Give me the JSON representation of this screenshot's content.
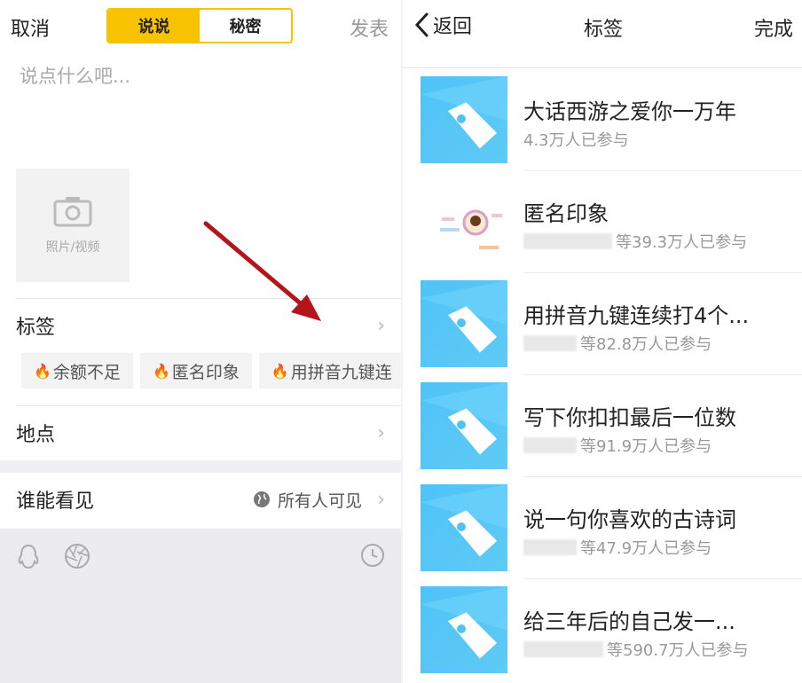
{
  "left": {
    "header": {
      "cancel": "取消",
      "tab_shuoshuo": "说说",
      "tab_secret": "秘密",
      "publish": "发表"
    },
    "compose_placeholder": "说点什么吧...",
    "photo_label": "照片/视频",
    "tags_row_label": "标签",
    "tags": [
      "余额不足",
      "匿名印象",
      "用拼音九键连"
    ],
    "location_label": "地点",
    "visibility_label": "谁能看见",
    "visibility_value": "所有人可见"
  },
  "right": {
    "header": {
      "back": "返回",
      "title": "标签",
      "done": "完成"
    },
    "items": [
      {
        "name": "大话西游之爱你一万年",
        "count": "4.3万人已参与"
      },
      {
        "name": "匿名印象",
        "count": "等39.3万人已参与"
      },
      {
        "name": "用拼音九键连续打4个...",
        "count": "等82.8万人已参与"
      },
      {
        "name": "写下你扣扣最后一位数",
        "count": "等91.9万人已参与"
      },
      {
        "name": "说一句你喜欢的古诗词",
        "count": "等47.9万人已参与"
      },
      {
        "name": "给三年后的自己发一...",
        "count": "等590.7万人已参与"
      }
    ]
  },
  "colors": {
    "accent": "#f7c300",
    "tag_thumb": "#4fc3f7",
    "arrow": "#b5141b"
  }
}
